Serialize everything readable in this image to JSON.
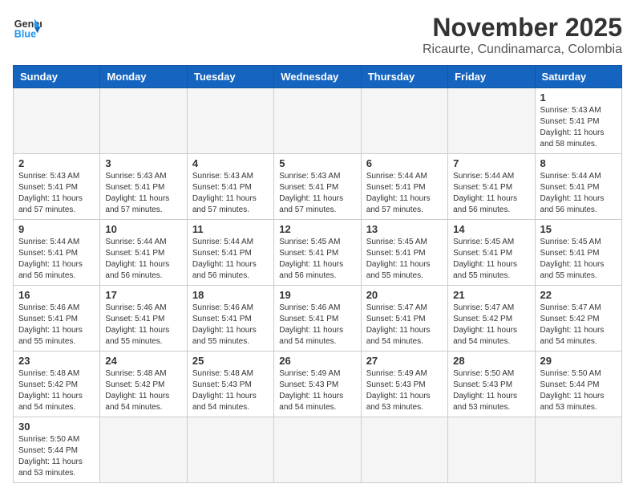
{
  "logo": {
    "text_general": "General",
    "text_blue": "Blue"
  },
  "header": {
    "month": "November 2025",
    "location": "Ricaurte, Cundinamarca, Colombia"
  },
  "weekdays": [
    "Sunday",
    "Monday",
    "Tuesday",
    "Wednesday",
    "Thursday",
    "Friday",
    "Saturday"
  ],
  "weeks": [
    [
      {
        "day": "",
        "info": ""
      },
      {
        "day": "",
        "info": ""
      },
      {
        "day": "",
        "info": ""
      },
      {
        "day": "",
        "info": ""
      },
      {
        "day": "",
        "info": ""
      },
      {
        "day": "",
        "info": ""
      },
      {
        "day": "1",
        "info": "Sunrise: 5:43 AM\nSunset: 5:41 PM\nDaylight: 11 hours\nand 58 minutes."
      }
    ],
    [
      {
        "day": "2",
        "info": "Sunrise: 5:43 AM\nSunset: 5:41 PM\nDaylight: 11 hours\nand 57 minutes."
      },
      {
        "day": "3",
        "info": "Sunrise: 5:43 AM\nSunset: 5:41 PM\nDaylight: 11 hours\nand 57 minutes."
      },
      {
        "day": "4",
        "info": "Sunrise: 5:43 AM\nSunset: 5:41 PM\nDaylight: 11 hours\nand 57 minutes."
      },
      {
        "day": "5",
        "info": "Sunrise: 5:43 AM\nSunset: 5:41 PM\nDaylight: 11 hours\nand 57 minutes."
      },
      {
        "day": "6",
        "info": "Sunrise: 5:44 AM\nSunset: 5:41 PM\nDaylight: 11 hours\nand 57 minutes."
      },
      {
        "day": "7",
        "info": "Sunrise: 5:44 AM\nSunset: 5:41 PM\nDaylight: 11 hours\nand 56 minutes."
      },
      {
        "day": "8",
        "info": "Sunrise: 5:44 AM\nSunset: 5:41 PM\nDaylight: 11 hours\nand 56 minutes."
      }
    ],
    [
      {
        "day": "9",
        "info": "Sunrise: 5:44 AM\nSunset: 5:41 PM\nDaylight: 11 hours\nand 56 minutes."
      },
      {
        "day": "10",
        "info": "Sunrise: 5:44 AM\nSunset: 5:41 PM\nDaylight: 11 hours\nand 56 minutes."
      },
      {
        "day": "11",
        "info": "Sunrise: 5:44 AM\nSunset: 5:41 PM\nDaylight: 11 hours\nand 56 minutes."
      },
      {
        "day": "12",
        "info": "Sunrise: 5:45 AM\nSunset: 5:41 PM\nDaylight: 11 hours\nand 56 minutes."
      },
      {
        "day": "13",
        "info": "Sunrise: 5:45 AM\nSunset: 5:41 PM\nDaylight: 11 hours\nand 55 minutes."
      },
      {
        "day": "14",
        "info": "Sunrise: 5:45 AM\nSunset: 5:41 PM\nDaylight: 11 hours\nand 55 minutes."
      },
      {
        "day": "15",
        "info": "Sunrise: 5:45 AM\nSunset: 5:41 PM\nDaylight: 11 hours\nand 55 minutes."
      }
    ],
    [
      {
        "day": "16",
        "info": "Sunrise: 5:46 AM\nSunset: 5:41 PM\nDaylight: 11 hours\nand 55 minutes."
      },
      {
        "day": "17",
        "info": "Sunrise: 5:46 AM\nSunset: 5:41 PM\nDaylight: 11 hours\nand 55 minutes."
      },
      {
        "day": "18",
        "info": "Sunrise: 5:46 AM\nSunset: 5:41 PM\nDaylight: 11 hours\nand 55 minutes."
      },
      {
        "day": "19",
        "info": "Sunrise: 5:46 AM\nSunset: 5:41 PM\nDaylight: 11 hours\nand 54 minutes."
      },
      {
        "day": "20",
        "info": "Sunrise: 5:47 AM\nSunset: 5:41 PM\nDaylight: 11 hours\nand 54 minutes."
      },
      {
        "day": "21",
        "info": "Sunrise: 5:47 AM\nSunset: 5:42 PM\nDaylight: 11 hours\nand 54 minutes."
      },
      {
        "day": "22",
        "info": "Sunrise: 5:47 AM\nSunset: 5:42 PM\nDaylight: 11 hours\nand 54 minutes."
      }
    ],
    [
      {
        "day": "23",
        "info": "Sunrise: 5:48 AM\nSunset: 5:42 PM\nDaylight: 11 hours\nand 54 minutes."
      },
      {
        "day": "24",
        "info": "Sunrise: 5:48 AM\nSunset: 5:42 PM\nDaylight: 11 hours\nand 54 minutes."
      },
      {
        "day": "25",
        "info": "Sunrise: 5:48 AM\nSunset: 5:43 PM\nDaylight: 11 hours\nand 54 minutes."
      },
      {
        "day": "26",
        "info": "Sunrise: 5:49 AM\nSunset: 5:43 PM\nDaylight: 11 hours\nand 54 minutes."
      },
      {
        "day": "27",
        "info": "Sunrise: 5:49 AM\nSunset: 5:43 PM\nDaylight: 11 hours\nand 53 minutes."
      },
      {
        "day": "28",
        "info": "Sunrise: 5:50 AM\nSunset: 5:43 PM\nDaylight: 11 hours\nand 53 minutes."
      },
      {
        "day": "29",
        "info": "Sunrise: 5:50 AM\nSunset: 5:44 PM\nDaylight: 11 hours\nand 53 minutes."
      }
    ],
    [
      {
        "day": "30",
        "info": "Sunrise: 5:50 AM\nSunset: 5:44 PM\nDaylight: 11 hours\nand 53 minutes."
      },
      {
        "day": "",
        "info": ""
      },
      {
        "day": "",
        "info": ""
      },
      {
        "day": "",
        "info": ""
      },
      {
        "day": "",
        "info": ""
      },
      {
        "day": "",
        "info": ""
      },
      {
        "day": "",
        "info": ""
      }
    ]
  ]
}
